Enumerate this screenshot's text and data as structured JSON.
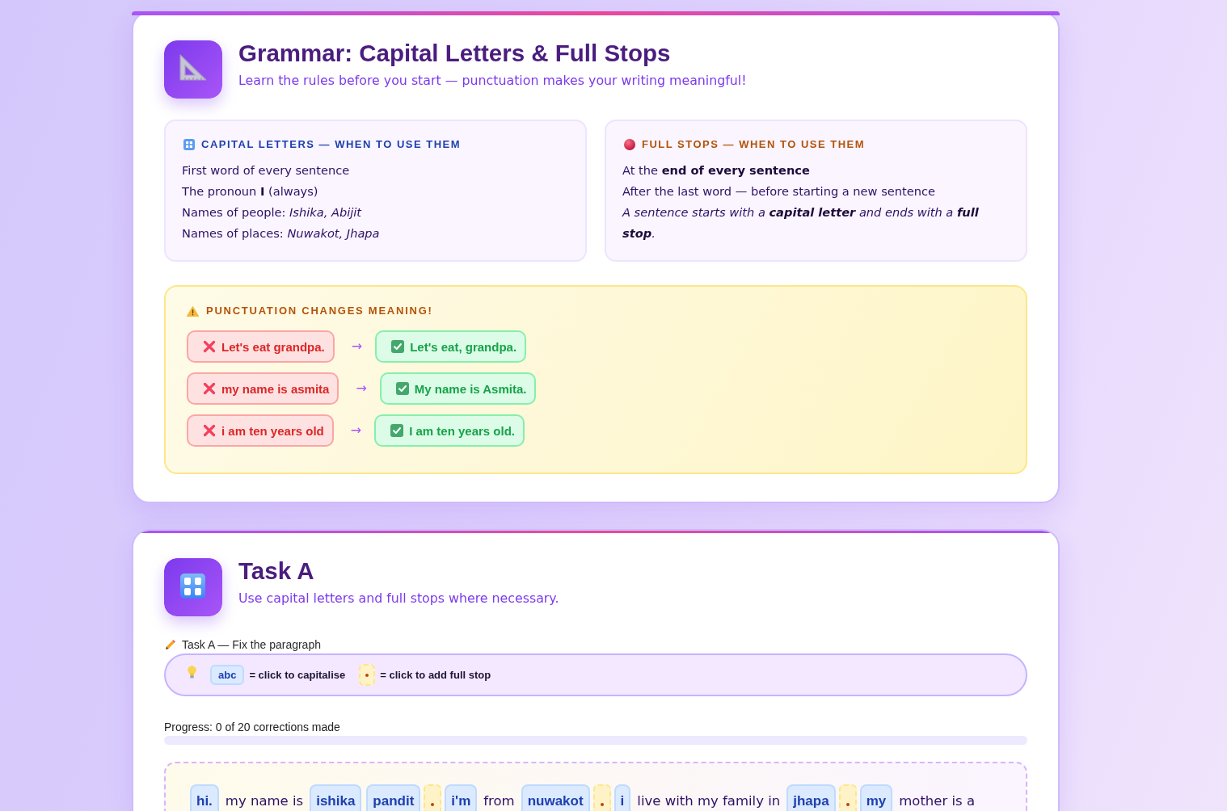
{
  "lesson_card": {
    "title": "Grammar: Capital Letters & Full Stops",
    "subtitle": "Learn the rules before you start — punctuation makes your writing meaningful!",
    "rule_boxes": [
      {
        "kind": "capital",
        "heading": "CAPITAL LETTERS — WHEN TO USE THEM",
        "lines": [
          {
            "text": "First word of every sentence",
            "italic": false
          },
          {
            "text": "The pronoun **I** (always)",
            "italic": false
          },
          {
            "text": "Names of people: *Ishika, Abijit*",
            "italic": false
          },
          {
            "text": "Names of places: *Nuwakot, Jhapa*",
            "italic": false
          }
        ]
      },
      {
        "kind": "stop",
        "heading": "FULL STOPS — WHEN TO USE THEM",
        "lines": [
          {
            "text": "At the **end of every sentence**",
            "italic": false
          },
          {
            "text": "After the last word — before starting a new sentence",
            "italic": false
          },
          {
            "text": "A sentence starts with a **capital letter** and ends with a **full stop**.",
            "italic": true
          }
        ]
      }
    ],
    "warning": {
      "heading": "PUNCTUATION CHANGES MEANING!",
      "examples": [
        {
          "wrong": "Let's eat grandpa.",
          "arrow": "→",
          "correct": "Let's eat, grandpa."
        },
        {
          "wrong": "my name is asmita",
          "arrow": "→",
          "correct": "My name is Asmita."
        },
        {
          "wrong": "i am ten years old",
          "arrow": "→",
          "correct": "I am ten years old."
        }
      ]
    }
  },
  "task_card": {
    "title": "Task A",
    "subtitle": "Use capital letters and full stops where necessary.",
    "label": "Task A — Fix the paragraph",
    "legend": {
      "sample_word": "abc",
      "capitalise_hint": "= click to capitalise",
      "stop_hint": "= click to add full stop"
    },
    "progress": {
      "text": "Progress: 0 of 20 corrections made",
      "level": 0
    },
    "paragraph": [
      {
        "kind": "word",
        "text": "hi."
      },
      {
        "kind": "text",
        "text": "my name is"
      },
      {
        "kind": "word",
        "text": "ishika"
      },
      {
        "kind": "word",
        "text": "pandit"
      },
      {
        "kind": "stop"
      },
      {
        "kind": "word",
        "text": "i'm"
      },
      {
        "kind": "text",
        "text": "from"
      },
      {
        "kind": "word",
        "text": "nuwakot"
      },
      {
        "kind": "stop"
      },
      {
        "kind": "word",
        "text": "i"
      },
      {
        "kind": "text",
        "text": "live with my family in"
      },
      {
        "kind": "word",
        "text": "jhapa"
      },
      {
        "kind": "stop"
      },
      {
        "kind": "word",
        "text": "my"
      },
      {
        "kind": "text",
        "text": "mother is a"
      }
    ]
  }
}
